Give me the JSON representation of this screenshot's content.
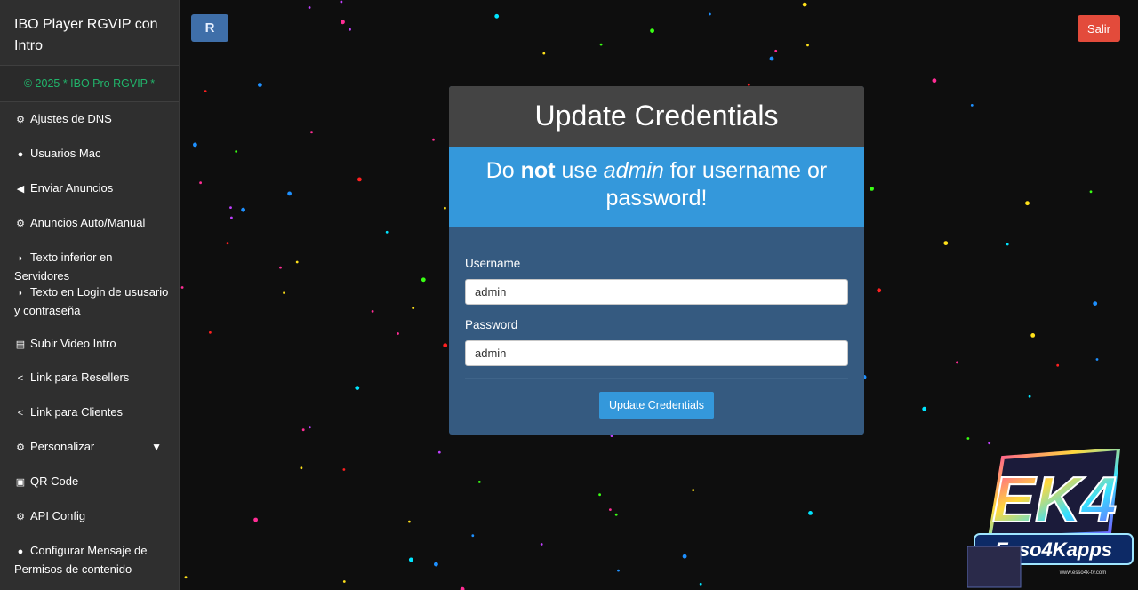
{
  "sidebar": {
    "brand": "IBO Player RGVIP con Intro",
    "copyright": "© 2025 * IBO Pro RGVIP *",
    "items": [
      {
        "label": "Ajustes de DNS",
        "icon": "gears-icon"
      },
      {
        "label": "Usuarios Mac",
        "icon": "user-icon"
      },
      {
        "label": "Enviar Anuncios",
        "icon": "bullhorn-icon"
      },
      {
        "label": "Anuncios Auto/Manual",
        "icon": "gears-icon"
      },
      {
        "label": "Texto inferior en Servidores",
        "icon": "rss-icon"
      },
      {
        "label": "Texto en Login de ususario y contraseña",
        "icon": "rss-icon"
      },
      {
        "label": "Subir Video Intro",
        "icon": "film-icon"
      },
      {
        "label": "Link para Resellers",
        "icon": "share-icon"
      },
      {
        "label": "Link para Clientes",
        "icon": "share-icon"
      },
      {
        "label": "Personalizar",
        "icon": "gears-icon"
      },
      {
        "label": "QR Code",
        "icon": "image-icon"
      },
      {
        "label": "API Config",
        "icon": "gears-icon"
      },
      {
        "label": "Configurar Mensaje de Permisos de contenido",
        "icon": "comment-icon"
      }
    ]
  },
  "header": {
    "logo_letter": "R",
    "logout_label": "Salir",
    "logout_color": "#e34b3b"
  },
  "panel": {
    "title": "Update Credentials",
    "warning": {
      "part1": "Do ",
      "strong": "not",
      "part2": " use ",
      "em": "admin",
      "part3": " for username or password!"
    },
    "username_label": "Username",
    "username_value": "admin",
    "password_label": "Password",
    "password_value": "admin",
    "submit_label": "Update Credentials",
    "accent_color": "#3498db"
  },
  "watermark": {
    "logo_text": "EK4",
    "name": "Esso4Kapps",
    "url": "www.esso4k-tv.com"
  }
}
